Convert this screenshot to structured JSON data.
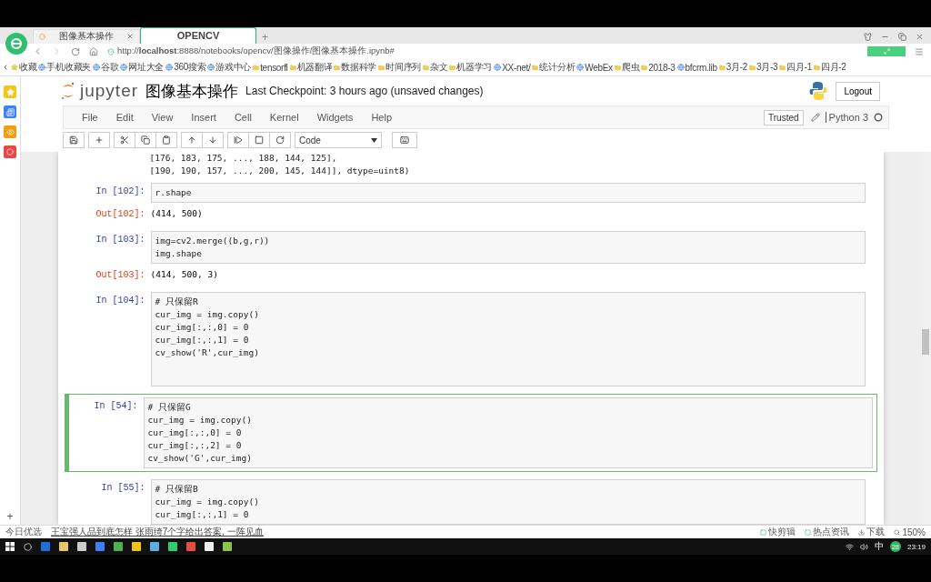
{
  "browser": {
    "tabs": [
      {
        "label": "图像基本操作",
        "selected": false
      },
      {
        "label": "OPENCV",
        "selected": true
      }
    ],
    "new_tab": "+",
    "url": "http://**localhost**:8888/notebooks/opencv/图像操作/图像基本操作.ipynb#",
    "bookmarks": [
      {
        "label": "收藏",
        "kind": "star"
      },
      {
        "label": "手机收藏夹",
        "kind": "site"
      },
      {
        "label": "谷歌",
        "kind": "site"
      },
      {
        "label": "网址大全",
        "kind": "site"
      },
      {
        "label": "360搜索",
        "kind": "site"
      },
      {
        "label": "游戏中心",
        "kind": "site"
      },
      {
        "label": "tensorfl",
        "kind": "folder"
      },
      {
        "label": "机器翻译",
        "kind": "folder"
      },
      {
        "label": "数据科学",
        "kind": "folder"
      },
      {
        "label": "时间序列",
        "kind": "folder"
      },
      {
        "label": "杂文",
        "kind": "folder"
      },
      {
        "label": "机器学习",
        "kind": "folder"
      },
      {
        "label": "XX-net/",
        "kind": "site"
      },
      {
        "label": "统计分析",
        "kind": "folder"
      },
      {
        "label": "WebEx",
        "kind": "site"
      },
      {
        "label": "爬虫",
        "kind": "folder"
      },
      {
        "label": "2018-3",
        "kind": "folder"
      },
      {
        "label": "bfcrm.lib",
        "kind": "site"
      },
      {
        "label": "3月-2",
        "kind": "folder"
      },
      {
        "label": "3月-3",
        "kind": "folder"
      },
      {
        "label": "四月-1",
        "kind": "folder"
      },
      {
        "label": "四月-2",
        "kind": "folder"
      }
    ],
    "sidebar_add": "+"
  },
  "notebook": {
    "brand": "jupyter",
    "title": "图像基本操作",
    "checkpoint": "Last Checkpoint: 3 hours ago (unsaved changes)",
    "logout": "Logout",
    "menu": [
      "File",
      "Edit",
      "View",
      "Insert",
      "Cell",
      "Kernel",
      "Widgets",
      "Help"
    ],
    "trusted": "Trusted",
    "kernel": "Python 3",
    "kernel_busy": false,
    "cell_type": "Code",
    "cells": [
      {
        "kind": "output",
        "lines": [
          "[176, 183, 175, ..., 188, 144, 125],",
          "[190, 190, 157, ..., 200, 145, 144]], dtype=uint8)"
        ]
      },
      {
        "kind": "code",
        "prompt": "In [102]:",
        "selected": false,
        "tall": false,
        "lines": [
          "r.shape"
        ],
        "out_prompt": "Out[102]:",
        "out": "(414, 500)"
      },
      {
        "kind": "code",
        "prompt": "In [103]:",
        "selected": false,
        "tall": false,
        "lines": [
          "img=cv2.merge((b,g,r))",
          "img.shape"
        ],
        "out_prompt": "Out[103]:",
        "out": "(414, 500, 3)"
      },
      {
        "kind": "code",
        "prompt": "In [104]:",
        "selected": false,
        "tall": true,
        "lines": [
          "# 只保留R",
          "cur_img = img.copy()",
          "cur_img[:,:,0] = 0",
          "cur_img[:,:,1] = 0",
          "cv_show('R',cur_img)"
        ]
      },
      {
        "kind": "code",
        "prompt": "In [54]:",
        "selected": true,
        "tall": false,
        "lines": [
          "# 只保留G",
          "cur_img = img.copy()",
          "cur_img[:,:,0] = 0",
          "cur_img[:,:,2] = 0",
          "cv_show('G',cur_img)"
        ]
      },
      {
        "kind": "code",
        "prompt": "In [55]:",
        "selected": false,
        "tall": false,
        "lines": [
          "# 只保留B",
          "cur_img = img.copy()",
          "cur_img[:,:,1] = 0"
        ]
      }
    ]
  },
  "status_bar": {
    "left": "今日优选",
    "headline": "王宝强人品到底怎样 张雨绮7个字给出答案, 一阵见血",
    "right": [
      "快剪辑",
      "热点资讯",
      "下载"
    ],
    "zoom": "150%"
  },
  "taskbar": {
    "ime": "中",
    "badge": "28",
    "time": "23:19"
  }
}
